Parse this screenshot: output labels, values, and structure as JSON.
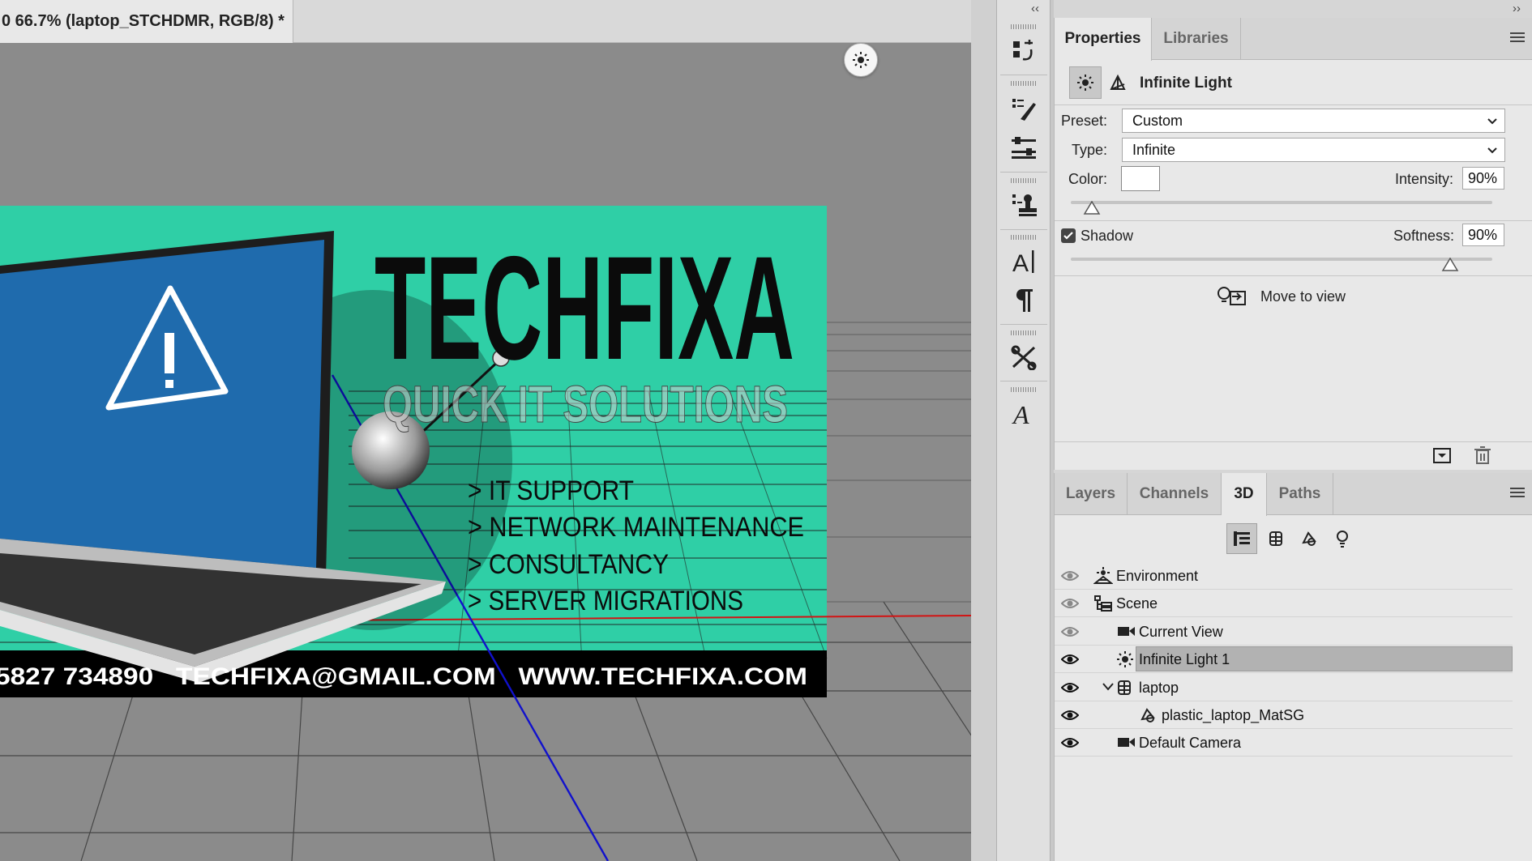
{
  "document": {
    "tab_title": "0 66.7% (laptop_STCHDMR, RGB/8) *"
  },
  "artwork": {
    "brand": "TECHFIXA",
    "tagline": "QUICK IT SOLUTIONS",
    "services": [
      "> IT SUPPORT",
      "> NETWORK MAINTENANCE",
      "> CONSULTANCY",
      "> SERVER MIGRATIONS"
    ],
    "footer": "5827 734890   TECHFIXA@GMAIL.COM   WWW.TECHFIXA.COM",
    "accent_color": "#2fcfa6",
    "footer_color": "#000000"
  },
  "toolstrip": {
    "collapse_left": "‹‹",
    "collapse_right": "››",
    "tools": [
      "history-icon",
      "brush-presets-icon",
      "adjustments-icon",
      "clone-source-icon",
      "character-icon",
      "paragraph-icon",
      "tool-presets-icon",
      "glyphs-icon"
    ]
  },
  "properties": {
    "tabs": [
      "Properties",
      "Libraries"
    ],
    "active_tab": "Properties",
    "header_title": "Infinite Light",
    "preset_label": "Preset:",
    "preset_value": "Custom",
    "type_label": "Type:",
    "type_value": "Infinite",
    "color_label": "Color:",
    "color_value": "#ffffff",
    "intensity_label": "Intensity:",
    "intensity_value": "90%",
    "intensity_level": 0.05,
    "shadow_label": "Shadow",
    "shadow_checked": true,
    "softness_label": "Softness:",
    "softness_value": "90%",
    "softness_level": 0.9,
    "move_to_view_label": "Move to view"
  },
  "layers_panel": {
    "tabs": [
      "Layers",
      "Channels",
      "3D",
      "Paths"
    ],
    "active_tab": "3D",
    "items": [
      {
        "label": "Environment",
        "icon": "environment-icon",
        "indent": 0
      },
      {
        "label": "Scene",
        "icon": "scene-icon",
        "indent": 0
      },
      {
        "label": "Current View",
        "icon": "camera-icon",
        "indent": 1
      },
      {
        "label": "Infinite Light 1",
        "icon": "light-icon",
        "indent": 1,
        "selected": true
      },
      {
        "label": "laptop",
        "icon": "mesh-icon",
        "indent": 1,
        "expanded": true
      },
      {
        "label": "plastic_laptop_MatSG",
        "icon": "material-icon",
        "indent": 2
      },
      {
        "label": "Default Camera",
        "icon": "camera-icon",
        "indent": 1
      }
    ]
  }
}
